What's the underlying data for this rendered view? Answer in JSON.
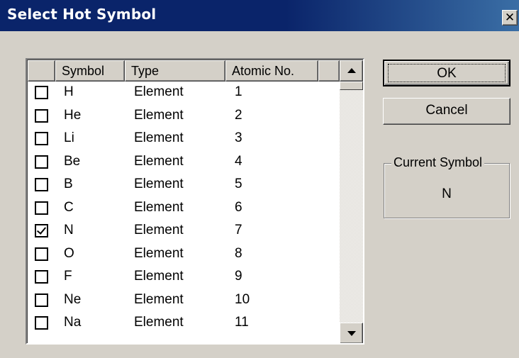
{
  "window": {
    "title": "Select Hot Symbol",
    "close_glyph": "✕",
    "title_bar_color": "#0a246a"
  },
  "list": {
    "columns": [
      "",
      "Symbol",
      "Type",
      "Atomic No.",
      ""
    ],
    "rows": [
      {
        "checked": false,
        "symbol": "H",
        "type": "Element",
        "number": "1"
      },
      {
        "checked": false,
        "symbol": "He",
        "type": "Element",
        "number": "2"
      },
      {
        "checked": false,
        "symbol": "Li",
        "type": "Element",
        "number": "3"
      },
      {
        "checked": false,
        "symbol": "Be",
        "type": "Element",
        "number": "4"
      },
      {
        "checked": false,
        "symbol": "B",
        "type": "Element",
        "number": "5"
      },
      {
        "checked": false,
        "symbol": "C",
        "type": "Element",
        "number": "6"
      },
      {
        "checked": true,
        "symbol": "N",
        "type": "Element",
        "number": "7"
      },
      {
        "checked": false,
        "symbol": "O",
        "type": "Element",
        "number": "8"
      },
      {
        "checked": false,
        "symbol": "F",
        "type": "Element",
        "number": "9"
      },
      {
        "checked": false,
        "symbol": "Ne",
        "type": "Element",
        "number": "10"
      },
      {
        "checked": false,
        "symbol": "Na",
        "type": "Element",
        "number": "11"
      }
    ]
  },
  "buttons": {
    "ok_label": "OK",
    "cancel_label": "Cancel"
  },
  "current_symbol": {
    "legend": "Current Symbol",
    "value": "N"
  },
  "icons": {
    "scroll_up": "scroll-up-arrow-icon",
    "scroll_down": "scroll-down-arrow-icon",
    "close": "close-icon"
  }
}
